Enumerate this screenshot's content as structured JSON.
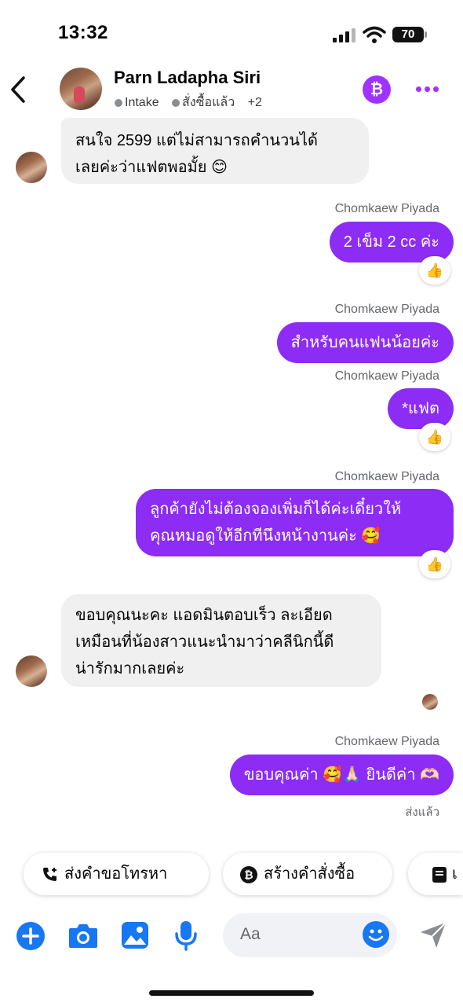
{
  "status_bar": {
    "time": "13:32",
    "battery": "70"
  },
  "header": {
    "contact_name": "Parn Ladapha Siri",
    "tags": [
      "Intake",
      "สั่งซื้อแล้ว"
    ],
    "more_tags": "+2",
    "action_icon": "bitcoin-icon",
    "accent": "#a033ff"
  },
  "messages": [
    {
      "type": "incoming",
      "lines": [
        "สนใจ 2599 แต่ไม่สามารถคำนวนได้",
        "เลยค่ะว่าแฟตพอมั้ย 😊"
      ]
    },
    {
      "type": "outgoing",
      "sender": "Chomkaew Piyada",
      "text": "2 เข็ม 2 cc ค่ะ",
      "reaction": "👍"
    },
    {
      "type": "outgoing",
      "sender": "Chomkaew Piyada",
      "text": "สำหรับคนแฟนน้อยค่ะ"
    },
    {
      "type": "outgoing",
      "sender": "Chomkaew Piyada",
      "text": "*แฟต",
      "reaction": "👍"
    },
    {
      "type": "outgoing",
      "sender": "Chomkaew Piyada",
      "lines": [
        "ลูกค้ายังไม่ต้องจองเพิ่มก็ได้ค่ะเดี๋ยวให้",
        "คุณหมอดูให้อีกทีนึงหน้างานค่ะ 🥰"
      ],
      "reaction": "👍"
    },
    {
      "type": "incoming",
      "lines": [
        "ขอบคุณนะคะ แอดมินตอบเร็ว ละเอียด",
        "เหมือนที่น้องสาวแนะนำมาว่าคลีนิกนี้ดี",
        "น่ารักมากเลยค่ะ"
      ]
    },
    {
      "type": "outgoing",
      "sender": "Chomkaew Piyada",
      "text": "ขอบคุณค่า 🥰🙏🏻  ยินดีค่า 🫶🏻",
      "status": "ส่งแล้ว"
    }
  ],
  "quick_actions": [
    {
      "label": "ส่งคำขอโทรหา",
      "icon": "phone-add-icon"
    },
    {
      "label": "สร้างคำสั่งซื้อ",
      "icon": "bitcoin-icon"
    },
    {
      "label": "เ",
      "icon": "note-icon"
    }
  ],
  "composer": {
    "placeholder": "Aa"
  },
  "colors": {
    "outgoing_bubble": "#8c2cf5",
    "incoming_bubble": "#f0f0f0",
    "toolbar_icons": "#1877f2"
  }
}
